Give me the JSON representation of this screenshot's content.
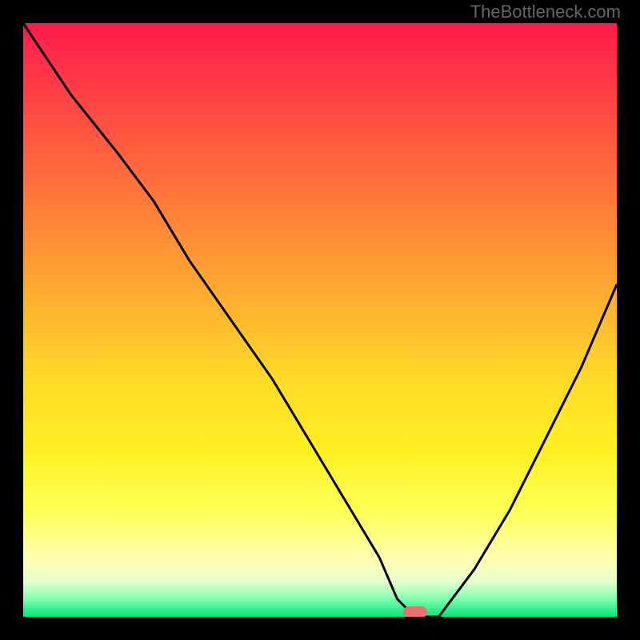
{
  "watermark": "TheBottleneck.com",
  "chart_data": {
    "type": "line",
    "title": "",
    "subtitle": "",
    "xlabel": "",
    "ylabel": "",
    "xlim": [
      0,
      100
    ],
    "ylim": [
      0,
      100
    ],
    "legend": false,
    "grid": false,
    "background": "traffic-light vertical gradient (red top → green bottom) with black border",
    "annotations": [
      {
        "type": "marker",
        "x": 66,
        "y": 0,
        "color": "#e8706f",
        "shape": "pill"
      }
    ],
    "series": [
      {
        "name": "bottleneck-curve",
        "x": [
          0,
          8,
          16,
          22,
          28,
          35,
          42,
          48,
          54,
          60,
          63,
          66,
          70,
          76,
          82,
          88,
          94,
          100
        ],
        "y": [
          100,
          88,
          78,
          70,
          60,
          50,
          40,
          30,
          20,
          10,
          3,
          0,
          0,
          8,
          18,
          30,
          42,
          56
        ],
        "color": "#000000",
        "stroke_width": 3
      }
    ]
  },
  "colors": {
    "frame": "#000000",
    "curve": "#000000",
    "marker": "#e8706f",
    "watermark": "#666666"
  }
}
